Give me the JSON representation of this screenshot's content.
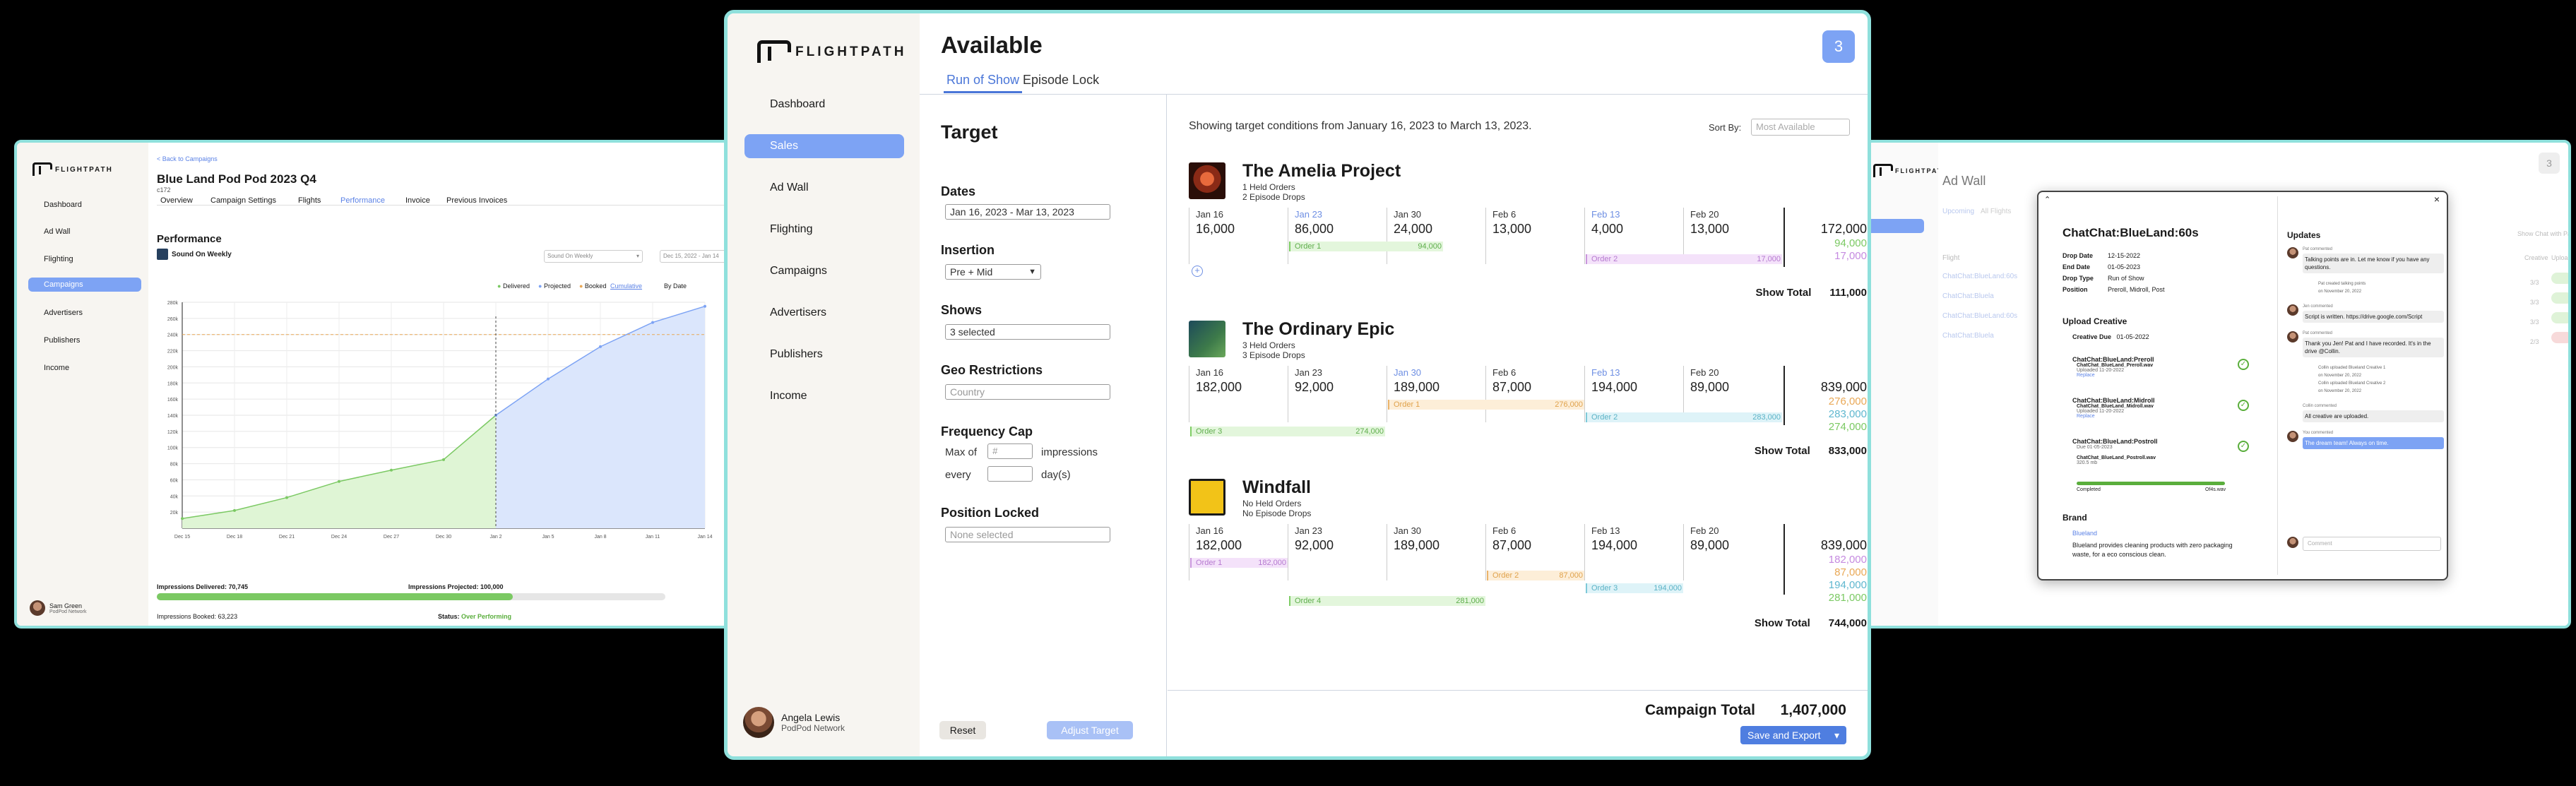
{
  "brand": "FLIGHTPATH",
  "left": {
    "nav": [
      "Dashboard",
      "Ad Wall",
      "Flighting",
      "Campaigns",
      "Advertisers",
      "Publishers",
      "Income"
    ],
    "active_nav": "Campaigns",
    "back_link": "< Back to Campaigns",
    "title": "Blue Land Pod Pod 2023 Q4",
    "subtitle": "c172",
    "tabs": [
      "Overview",
      "Campaign Settings",
      "Flights",
      "Performance",
      "Invoice",
      "Previous Invoices"
    ],
    "active_tab": "Performance",
    "section": "Performance",
    "show_name": "Sound On Weekly",
    "select_show": "Sound On Weekly",
    "select_date": "Dec 15, 2022 - Jan 14",
    "legend": [
      "Delivered",
      "Projected",
      "Booked"
    ],
    "toggle": [
      "Cumulative",
      "By Date"
    ],
    "y_ticks": [
      "280k",
      "260k",
      "240k",
      "220k",
      "200k",
      "180k",
      "160k",
      "140k",
      "120k",
      "100k",
      "80k",
      "60k",
      "40k",
      "20k"
    ],
    "x_ticks": [
      "Dec 15",
      "Dec 18",
      "Dec 21",
      "Dec 24",
      "Dec 27",
      "Dec 30",
      "Jan 2",
      "Jan 5",
      "Jan 8",
      "Jan 11",
      "Jan 14"
    ],
    "impressions_delivered": "Impressions Delivered: 70,745",
    "impressions_projected": "Impressions Projected: 100,000",
    "impressions_booked": "Impressions Booked: 63,223",
    "status_label": "Status:",
    "status_value": "Over Performing",
    "delivered_progress": 0.7,
    "user_name": "Sam Green",
    "user_org": "PodPod Network"
  },
  "chart_data": {
    "type": "area",
    "x": [
      "Dec 15",
      "Dec 18",
      "Dec 21",
      "Dec 24",
      "Dec 27",
      "Dec 30",
      "Jan 2",
      "Jan 5",
      "Jan 8",
      "Jan 11",
      "Jan 14"
    ],
    "series": [
      {
        "name": "Delivered",
        "values": [
          12000,
          22000,
          38000,
          58000,
          72000,
          85000,
          140000,
          null,
          null,
          null,
          null
        ]
      },
      {
        "name": "Projected",
        "values": [
          null,
          null,
          null,
          null,
          null,
          null,
          140000,
          185000,
          225000,
          255000,
          275000
        ]
      },
      {
        "name": "Booked",
        "values": [
          240000,
          240000,
          240000,
          240000,
          240000,
          240000,
          240000,
          240000,
          240000,
          240000,
          240000
        ]
      }
    ],
    "ylim": [
      0,
      280000
    ],
    "grid": true,
    "legend": "top-right"
  },
  "center": {
    "nav": [
      "Dashboard",
      "Sales",
      "Ad Wall",
      "Flighting",
      "Campaigns",
      "Advertisers",
      "Publishers",
      "Income"
    ],
    "active_nav": "Sales",
    "title": "Available",
    "badge": "3",
    "tabs": [
      "Run of Show",
      "Episode Lock"
    ],
    "target": {
      "heading": "Target",
      "dates_label": "Dates",
      "dates_value": "Jan 16, 2023 - Mar 13, 2023",
      "insertion_label": "Insertion",
      "insertion_value": "Pre + Mid",
      "shows_label": "Shows",
      "shows_value": "3 selected",
      "geo_label": "Geo Restrictions",
      "geo_placeholder": "Country",
      "freq_label": "Frequency Cap",
      "freq_max": "Max of",
      "freq_placeholder": "#",
      "freq_impressions": "impressions",
      "freq_every": "every",
      "freq_days": "day(s)",
      "position_label": "Position Locked",
      "position_placeholder": "None selected",
      "reset": "Reset",
      "adjust": "Adjust Target"
    },
    "info": "Showing target conditions from January 16, 2023 to March 13, 2023.",
    "sort_label": "Sort By:",
    "sort_placeholder": "Most Available",
    "dates": [
      "Jan 16",
      "Jan 23",
      "Jan 30",
      "Feb 6",
      "Feb 13",
      "Feb 20"
    ],
    "shows": [
      {
        "name": "The Amelia Project",
        "meta1": "1 Held Orders",
        "meta2": "2 Episode Drops",
        "values": [
          "16,000",
          "86,000",
          "24,000",
          "13,000",
          "4,000",
          "13,000"
        ],
        "total": "172,000",
        "sub_values": [
          "94,000",
          "17,000"
        ],
        "orders": [
          {
            "label": "Order 1",
            "amount": "94,000"
          },
          {
            "label": "Order 2",
            "amount": "17,000"
          }
        ],
        "show_total_label": "Show Total",
        "show_total": "111,000"
      },
      {
        "name": "The Ordinary Epic",
        "meta1": "3 Held Orders",
        "meta2": "3 Episode Drops",
        "values": [
          "182,000",
          "92,000",
          "189,000",
          "87,000",
          "194,000",
          "89,000"
        ],
        "total": "839,000",
        "sub_values": [
          "276,000",
          "283,000",
          "274,000"
        ],
        "orders": [
          {
            "label": "Order 1",
            "amount": "276,000"
          },
          {
            "label": "Order 2",
            "amount": "283,000"
          },
          {
            "label": "Order 3",
            "amount": "274,000"
          }
        ],
        "show_total_label": "Show Total",
        "show_total": "833,000"
      },
      {
        "name": "Windfall",
        "meta1": "No Held Orders",
        "meta2": "No Episode Drops",
        "values": [
          "182,000",
          "92,000",
          "189,000",
          "87,000",
          "194,000",
          "89,000"
        ],
        "total": "839,000",
        "sub_values": [
          "182,000",
          "87,000",
          "194,000",
          "281,000"
        ],
        "orders": [
          {
            "label": "Order 1",
            "amount": "182,000"
          },
          {
            "label": "Order 2",
            "amount": "87,000"
          },
          {
            "label": "Order 3",
            "amount": "194,000"
          },
          {
            "label": "Order 4",
            "amount": "281,000"
          }
        ],
        "show_total_label": "Show Total",
        "show_total": "744,000"
      }
    ],
    "campaign_total_label": "Campaign Total",
    "campaign_total": "1,407,000",
    "save": "Save and Export",
    "user_name": "Angela Lewis",
    "user_org": "PodPod Network"
  },
  "right": {
    "title": "Ad Wall",
    "badge": "3",
    "tabs": [
      "Upcoming",
      "All Flights"
    ],
    "col_flight": "Flight",
    "col_creative": "Creative",
    "col_upload": "Upload",
    "show_chat": "Show Chat with Pat and Pal",
    "rows": [
      "ChatChat:BlueLand:60s",
      "ChatChat:Bluela",
      "ChatChat:BlueLand:60s",
      "ChatChat:Bluela"
    ],
    "modal": {
      "title": "ChatChat:BlueLand:60s",
      "drop_date_label": "Drop Date",
      "drop_date": "12-15-2022",
      "end_date_label": "End Date",
      "end_date": "01-05-2023",
      "drop_type_label": "Drop Type",
      "drop_type": "Run of Show",
      "position_label": "Position",
      "position": "Preroll, Midroll, Post",
      "upload_heading": "Upload Creative",
      "creative_due_label": "Creative Due",
      "creative_due": "01-05-2022",
      "creatives": [
        {
          "name": "ChatChat:BlueLand:Preroll",
          "file": "ChatChat_BlueLand_Preroll.wav",
          "uploaded": "Uploaded 11-20-2022",
          "action": "Replace"
        },
        {
          "name": "ChatChat:BlueLand:Midroll",
          "file": "ChatChat_BlueLand_Midroll.wav",
          "uploaded": "Uploaded 11-20-2022",
          "action": "Replace"
        },
        {
          "name": "ChatChat:BlueLand:Postroll",
          "file": "ChatChat_BlueLand_Postroll.wav",
          "uploaded": "Due 01-05-2023",
          "action": "320.5 mb"
        }
      ],
      "progress_left": "Completed",
      "progress_right": "Of4s.wav",
      "brand_heading": "Brand",
      "brand_name": "Blueland",
      "brand_desc": "Blueland provides cleaning products with zero packaging waste, for a eco conscious clean.",
      "updates_heading": "Updates",
      "messages": [
        {
          "who": "Pat commented",
          "text": "Talking points are in. Let me know if you have any questions."
        },
        {
          "who": "Pat created talking points",
          "text": "on November 20, 2022"
        },
        {
          "who": "Jen commented",
          "text": "Script is written. https://drive.google.com/Script"
        },
        {
          "who": "Pat commented",
          "text": "Thank you Jen! Pat and I have recorded. It's in the drive @Collin."
        },
        {
          "who": "Collin uploaded Blueland Creative 1",
          "text": "on November 20, 2022"
        },
        {
          "who": "Collin uploaded Blueland Creative 2",
          "text": "on November 20, 2022"
        },
        {
          "who": "Collin commented",
          "text": "All creative are uploaded."
        },
        {
          "who": "You commented",
          "text": "The dream team! Always on time."
        }
      ],
      "comment_placeholder": "Comment"
    }
  }
}
